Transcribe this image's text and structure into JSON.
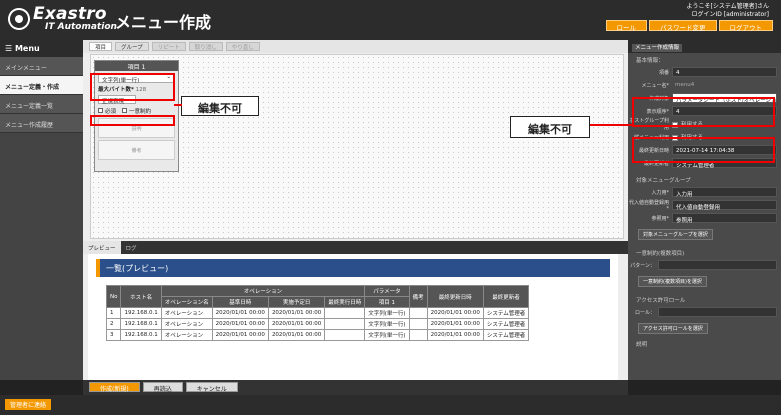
{
  "header": {
    "logo_main": "Exastro",
    "logo_sub": "IT Automation",
    "title": "メニュー作成",
    "welcome": "ようこそ[システム管理者]さん",
    "login_id": "ログインID [administrator]",
    "buttons": [
      "ロール",
      "パスワード変更",
      "ログアウト"
    ]
  },
  "sidebar": {
    "heading": "☰ Menu",
    "items": [
      "メインメニュー",
      "メニュー定義・作成",
      "メニュー定義一覧",
      "メニュー作成履歴"
    ]
  },
  "toolbar": [
    "項目",
    "グループ",
    "リピート",
    "取り消し",
    "やり直し"
  ],
  "item_box": {
    "title": "項目 1",
    "type": "文字列(単一行)",
    "max_label": "最大バイト数*",
    "max_val": "128",
    "regex_label": "正規表現",
    "check_required": "必須",
    "check_unique": "一意制約",
    "desc": "説明",
    "memo": "備考"
  },
  "callout_left": "編集不可",
  "callout_right": "編集不可",
  "preview": {
    "tabs": [
      "プレビュー",
      "ログ"
    ],
    "title": "一覧(プレビュー)",
    "group_headers": [
      "オペレーション",
      "パラメータ"
    ],
    "headers": [
      "No",
      "ホスト名",
      "オペレーション名",
      "基準日時",
      "実施予定日",
      "最終実行日時",
      "項目 1",
      "備考",
      "最終更新日時",
      "最終更新者"
    ],
    "rows": [
      [
        "1",
        "192.168.0.1",
        "オペレーション",
        "2020/01/01 00:00",
        "2020/01/01 00:00",
        "",
        "文字列(単一行)",
        "",
        "2020/01/01 00:00",
        "システム管理者"
      ],
      [
        "2",
        "192.168.0.1",
        "オペレーション",
        "2020/01/01 00:00",
        "2020/01/01 00:00",
        "",
        "文字列(単一行)",
        "",
        "2020/01/01 00:00",
        "システム管理者"
      ],
      [
        "3",
        "192.168.0.1",
        "オペレーション",
        "2020/01/01 00:00",
        "2020/01/01 00:00",
        "",
        "文字列(単一行)",
        "",
        "2020/01/01 00:00",
        "システム管理者"
      ]
    ]
  },
  "right": {
    "tab": "メニュー作成情報",
    "basic": "基本情報：",
    "item_label": "項番",
    "item_val": "4",
    "menu_name_label": "メニュー名*",
    "menu_name_val": "menu4",
    "target_label": "作成対象",
    "target_val": "パラメータシート（ホスト/オペレーション含む）",
    "order_label": "表示順序*",
    "order_val": "4",
    "hostgroup_label": "ホストグループ利用",
    "vertical_label": "縦メニュー利用",
    "use": "利用する",
    "updated_label": "最終更新日時",
    "updated_val": "2021-07-14 17:04:38",
    "updater_label": "最終更新者",
    "updater_val": "システム管理者",
    "target_group": "対象メニューグループ",
    "input_label": "入力用*",
    "input_val": "入力用",
    "sub_label": "代入値自動登録用*",
    "sub_val": "代入値自動登録用",
    "ref_label": "参照用*",
    "ref_val": "参照用",
    "select_group_btn": "対象メニューグループを選択",
    "unique": "一意制約(複数項目)",
    "pattern_label": "パターン：",
    "select_unique_btn": "一意制約(複数項目)を選択",
    "access": "アクセス許可ロール",
    "role_label": "ロール：",
    "select_role_btn": "アクセス許可ロールを選択",
    "note": "説明"
  },
  "bottom": [
    "作成(新規)",
    "再読込",
    "キャンセル"
  ],
  "footer": {
    "admin": "管理者に連絡"
  }
}
